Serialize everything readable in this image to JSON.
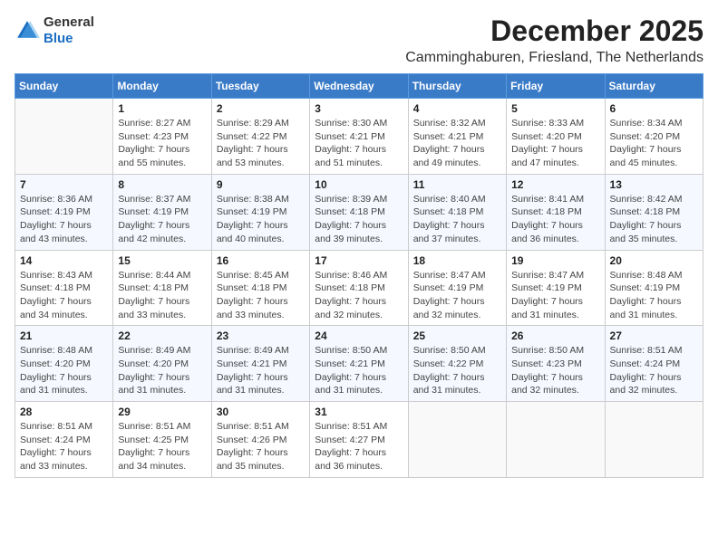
{
  "logo": {
    "general": "General",
    "blue": "Blue"
  },
  "header": {
    "title": "December 2025",
    "subtitle": "Camminghaburen, Friesland, The Netherlands"
  },
  "days_of_week": [
    "Sunday",
    "Monday",
    "Tuesday",
    "Wednesday",
    "Thursday",
    "Friday",
    "Saturday"
  ],
  "weeks": [
    [
      {
        "num": "",
        "sunrise": "",
        "sunset": "",
        "daylight": "",
        "empty": true
      },
      {
        "num": "1",
        "sunrise": "Sunrise: 8:27 AM",
        "sunset": "Sunset: 4:23 PM",
        "daylight": "Daylight: 7 hours and 55 minutes."
      },
      {
        "num": "2",
        "sunrise": "Sunrise: 8:29 AM",
        "sunset": "Sunset: 4:22 PM",
        "daylight": "Daylight: 7 hours and 53 minutes."
      },
      {
        "num": "3",
        "sunrise": "Sunrise: 8:30 AM",
        "sunset": "Sunset: 4:21 PM",
        "daylight": "Daylight: 7 hours and 51 minutes."
      },
      {
        "num": "4",
        "sunrise": "Sunrise: 8:32 AM",
        "sunset": "Sunset: 4:21 PM",
        "daylight": "Daylight: 7 hours and 49 minutes."
      },
      {
        "num": "5",
        "sunrise": "Sunrise: 8:33 AM",
        "sunset": "Sunset: 4:20 PM",
        "daylight": "Daylight: 7 hours and 47 minutes."
      },
      {
        "num": "6",
        "sunrise": "Sunrise: 8:34 AM",
        "sunset": "Sunset: 4:20 PM",
        "daylight": "Daylight: 7 hours and 45 minutes."
      }
    ],
    [
      {
        "num": "7",
        "sunrise": "Sunrise: 8:36 AM",
        "sunset": "Sunset: 4:19 PM",
        "daylight": "Daylight: 7 hours and 43 minutes."
      },
      {
        "num": "8",
        "sunrise": "Sunrise: 8:37 AM",
        "sunset": "Sunset: 4:19 PM",
        "daylight": "Daylight: 7 hours and 42 minutes."
      },
      {
        "num": "9",
        "sunrise": "Sunrise: 8:38 AM",
        "sunset": "Sunset: 4:19 PM",
        "daylight": "Daylight: 7 hours and 40 minutes."
      },
      {
        "num": "10",
        "sunrise": "Sunrise: 8:39 AM",
        "sunset": "Sunset: 4:18 PM",
        "daylight": "Daylight: 7 hours and 39 minutes."
      },
      {
        "num": "11",
        "sunrise": "Sunrise: 8:40 AM",
        "sunset": "Sunset: 4:18 PM",
        "daylight": "Daylight: 7 hours and 37 minutes."
      },
      {
        "num": "12",
        "sunrise": "Sunrise: 8:41 AM",
        "sunset": "Sunset: 4:18 PM",
        "daylight": "Daylight: 7 hours and 36 minutes."
      },
      {
        "num": "13",
        "sunrise": "Sunrise: 8:42 AM",
        "sunset": "Sunset: 4:18 PM",
        "daylight": "Daylight: 7 hours and 35 minutes."
      }
    ],
    [
      {
        "num": "14",
        "sunrise": "Sunrise: 8:43 AM",
        "sunset": "Sunset: 4:18 PM",
        "daylight": "Daylight: 7 hours and 34 minutes."
      },
      {
        "num": "15",
        "sunrise": "Sunrise: 8:44 AM",
        "sunset": "Sunset: 4:18 PM",
        "daylight": "Daylight: 7 hours and 33 minutes."
      },
      {
        "num": "16",
        "sunrise": "Sunrise: 8:45 AM",
        "sunset": "Sunset: 4:18 PM",
        "daylight": "Daylight: 7 hours and 33 minutes."
      },
      {
        "num": "17",
        "sunrise": "Sunrise: 8:46 AM",
        "sunset": "Sunset: 4:18 PM",
        "daylight": "Daylight: 7 hours and 32 minutes."
      },
      {
        "num": "18",
        "sunrise": "Sunrise: 8:47 AM",
        "sunset": "Sunset: 4:19 PM",
        "daylight": "Daylight: 7 hours and 32 minutes."
      },
      {
        "num": "19",
        "sunrise": "Sunrise: 8:47 AM",
        "sunset": "Sunset: 4:19 PM",
        "daylight": "Daylight: 7 hours and 31 minutes."
      },
      {
        "num": "20",
        "sunrise": "Sunrise: 8:48 AM",
        "sunset": "Sunset: 4:19 PM",
        "daylight": "Daylight: 7 hours and 31 minutes."
      }
    ],
    [
      {
        "num": "21",
        "sunrise": "Sunrise: 8:48 AM",
        "sunset": "Sunset: 4:20 PM",
        "daylight": "Daylight: 7 hours and 31 minutes."
      },
      {
        "num": "22",
        "sunrise": "Sunrise: 8:49 AM",
        "sunset": "Sunset: 4:20 PM",
        "daylight": "Daylight: 7 hours and 31 minutes."
      },
      {
        "num": "23",
        "sunrise": "Sunrise: 8:49 AM",
        "sunset": "Sunset: 4:21 PM",
        "daylight": "Daylight: 7 hours and 31 minutes."
      },
      {
        "num": "24",
        "sunrise": "Sunrise: 8:50 AM",
        "sunset": "Sunset: 4:21 PM",
        "daylight": "Daylight: 7 hours and 31 minutes."
      },
      {
        "num": "25",
        "sunrise": "Sunrise: 8:50 AM",
        "sunset": "Sunset: 4:22 PM",
        "daylight": "Daylight: 7 hours and 31 minutes."
      },
      {
        "num": "26",
        "sunrise": "Sunrise: 8:50 AM",
        "sunset": "Sunset: 4:23 PM",
        "daylight": "Daylight: 7 hours and 32 minutes."
      },
      {
        "num": "27",
        "sunrise": "Sunrise: 8:51 AM",
        "sunset": "Sunset: 4:24 PM",
        "daylight": "Daylight: 7 hours and 32 minutes."
      }
    ],
    [
      {
        "num": "28",
        "sunrise": "Sunrise: 8:51 AM",
        "sunset": "Sunset: 4:24 PM",
        "daylight": "Daylight: 7 hours and 33 minutes."
      },
      {
        "num": "29",
        "sunrise": "Sunrise: 8:51 AM",
        "sunset": "Sunset: 4:25 PM",
        "daylight": "Daylight: 7 hours and 34 minutes."
      },
      {
        "num": "30",
        "sunrise": "Sunrise: 8:51 AM",
        "sunset": "Sunset: 4:26 PM",
        "daylight": "Daylight: 7 hours and 35 minutes."
      },
      {
        "num": "31",
        "sunrise": "Sunrise: 8:51 AM",
        "sunset": "Sunset: 4:27 PM",
        "daylight": "Daylight: 7 hours and 36 minutes."
      },
      {
        "num": "",
        "sunrise": "",
        "sunset": "",
        "daylight": "",
        "empty": true
      },
      {
        "num": "",
        "sunrise": "",
        "sunset": "",
        "daylight": "",
        "empty": true
      },
      {
        "num": "",
        "sunrise": "",
        "sunset": "",
        "daylight": "",
        "empty": true
      }
    ]
  ]
}
